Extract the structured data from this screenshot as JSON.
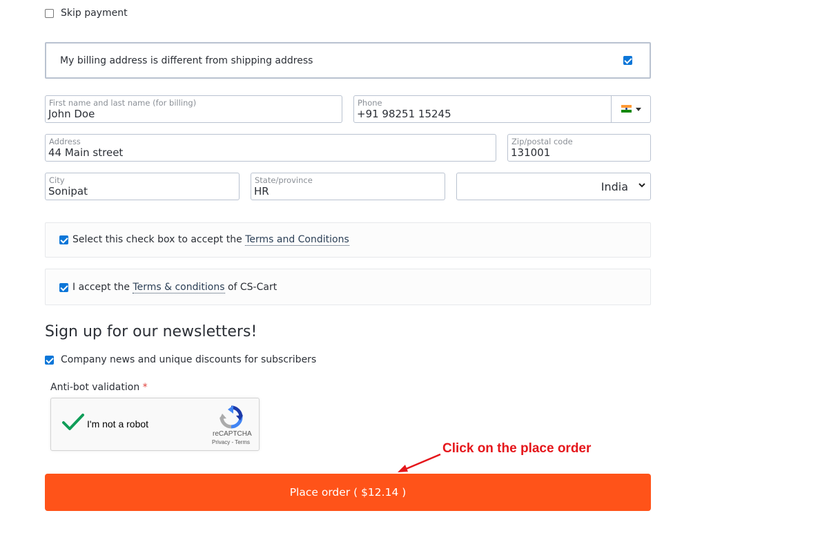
{
  "payment": {
    "skip_label": "Skip payment",
    "skip_checked": false
  },
  "billing": {
    "different_label": "My billing address is different from shipping address",
    "different_checked": true,
    "fields": {
      "name": {
        "label": "First name and last name (for billing)",
        "value": "John Doe"
      },
      "phone": {
        "label": "Phone",
        "value": "+91 98251 15245",
        "flag_icon": "india-flag-icon"
      },
      "address": {
        "label": "Address",
        "value": "44 Main street"
      },
      "zip": {
        "label": "Zip/postal code",
        "value": "131001"
      },
      "city": {
        "label": "City",
        "value": "Sonipat"
      },
      "state": {
        "label": "State/province",
        "value": "HR"
      },
      "country": {
        "value": "India"
      }
    }
  },
  "terms": {
    "checkbox1": {
      "prefix": "Select this check box to accept the ",
      "link": "Terms and Conditions",
      "checked": true
    },
    "checkbox2": {
      "prefix": "I accept the ",
      "link": "Terms & conditions",
      "suffix": " of CS-Cart",
      "checked": true
    }
  },
  "newsletter": {
    "title": "Sign up for our newsletters!",
    "option_label": "Company news and unique discounts for subscribers",
    "option_checked": true
  },
  "antibot": {
    "label": "Anti-bot validation",
    "required_mark": "*",
    "recaptcha": {
      "label": "I'm not a robot",
      "brand": "reCAPTCHA",
      "privacy": "Privacy",
      "separator": " - ",
      "terms": "Terms",
      "verified": true
    }
  },
  "annotation": {
    "text": "Click on the place order",
    "color": "#e5161b"
  },
  "order": {
    "button_label": "Place order ( $12.14 )",
    "button_color": "#ff5319"
  }
}
